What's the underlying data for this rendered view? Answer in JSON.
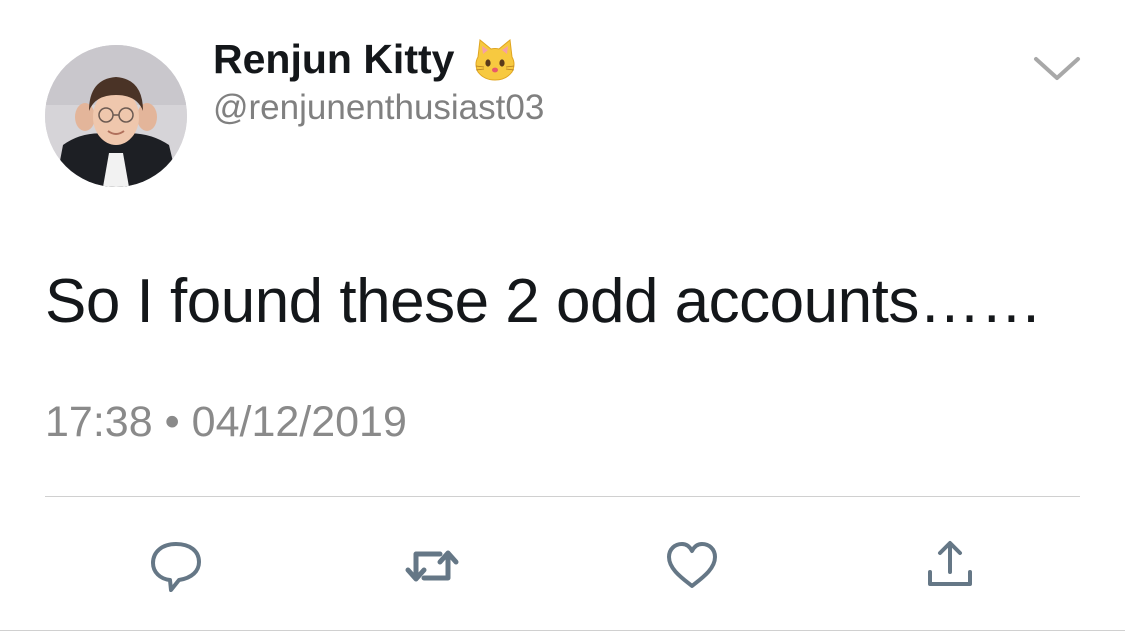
{
  "user": {
    "display_name": "Renjun Kitty",
    "emoji_icon": "cat-face-icon",
    "handle": "@renjunenthusiast03"
  },
  "tweet": {
    "text": "So I found these 2 odd accounts……",
    "time": "17:38",
    "separator": "•",
    "date": "04/12/2019"
  },
  "actions": {
    "reply_icon": "reply-icon",
    "retweet_icon": "retweet-icon",
    "like_icon": "heart-icon",
    "share_icon": "share-icon"
  },
  "colors": {
    "icon": "#657786",
    "secondary_text": "#8a8a8a",
    "primary_text": "#14171a"
  }
}
